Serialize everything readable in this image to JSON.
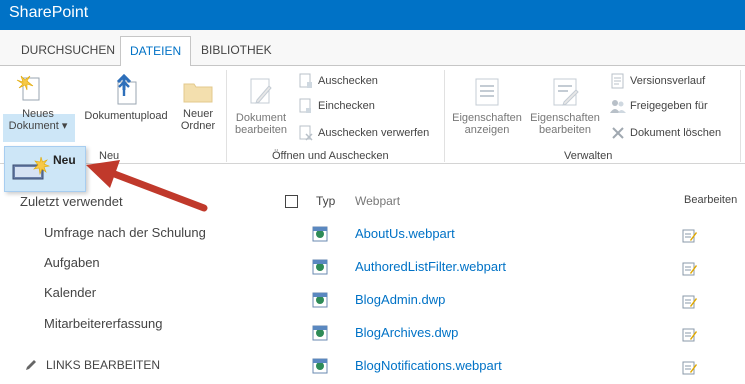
{
  "suite_bar": {
    "brand": "SharePoint"
  },
  "tabs": [
    {
      "label": "DURCHSUCHEN"
    },
    {
      "label": "DATEIEN",
      "active": true
    },
    {
      "label": "BIBLIOTHEK"
    }
  ],
  "ribbon": {
    "groups": {
      "new": "Neu",
      "open_checkout": "Öffnen und Auschecken",
      "manage": "Verwalten"
    },
    "new_document": {
      "line1": "Neues",
      "line2": "Dokument"
    },
    "upload": "Dokumentupload",
    "new_folder": {
      "line1": "Neuer",
      "line2": "Ordner"
    },
    "edit_document": {
      "line1": "Dokument",
      "line2": "bearbeiten"
    },
    "checkout": "Auschecken",
    "checkin": "Einchecken",
    "discard_checkout": "Auschecken verwerfen",
    "view_properties": {
      "line1": "Eigenschaften",
      "line2": "anzeigen"
    },
    "edit_properties": {
      "line1": "Eigenschaften",
      "line2": "bearbeiten"
    },
    "version_history": "Versionsverlauf",
    "shared_with": "Freigegeben für",
    "delete_document": "Dokument löschen"
  },
  "dropdown": {
    "new_label": "Neu"
  },
  "quick_launch": {
    "heading": "Zuletzt verwendet",
    "items": [
      "Umfrage nach der Schulung",
      "Aufgaben",
      "Kalender",
      "Mitarbeitererfassung"
    ],
    "edit_links": "LINKS BEARBEITEN"
  },
  "list": {
    "col_type": "Typ",
    "col_name": "Webpart",
    "col_edit": "Bearbeiten",
    "rows": [
      {
        "name": "AboutUs.webpart"
      },
      {
        "name": "AuthoredListFilter.webpart"
      },
      {
        "name": "BlogAdmin.dwp"
      },
      {
        "name": "BlogArchives.dwp"
      },
      {
        "name": "BlogNotifications.webpart"
      }
    ]
  },
  "colors": {
    "brand": "#0072c6",
    "arrow": "#c0392b",
    "highlight": "#cde6f7"
  }
}
